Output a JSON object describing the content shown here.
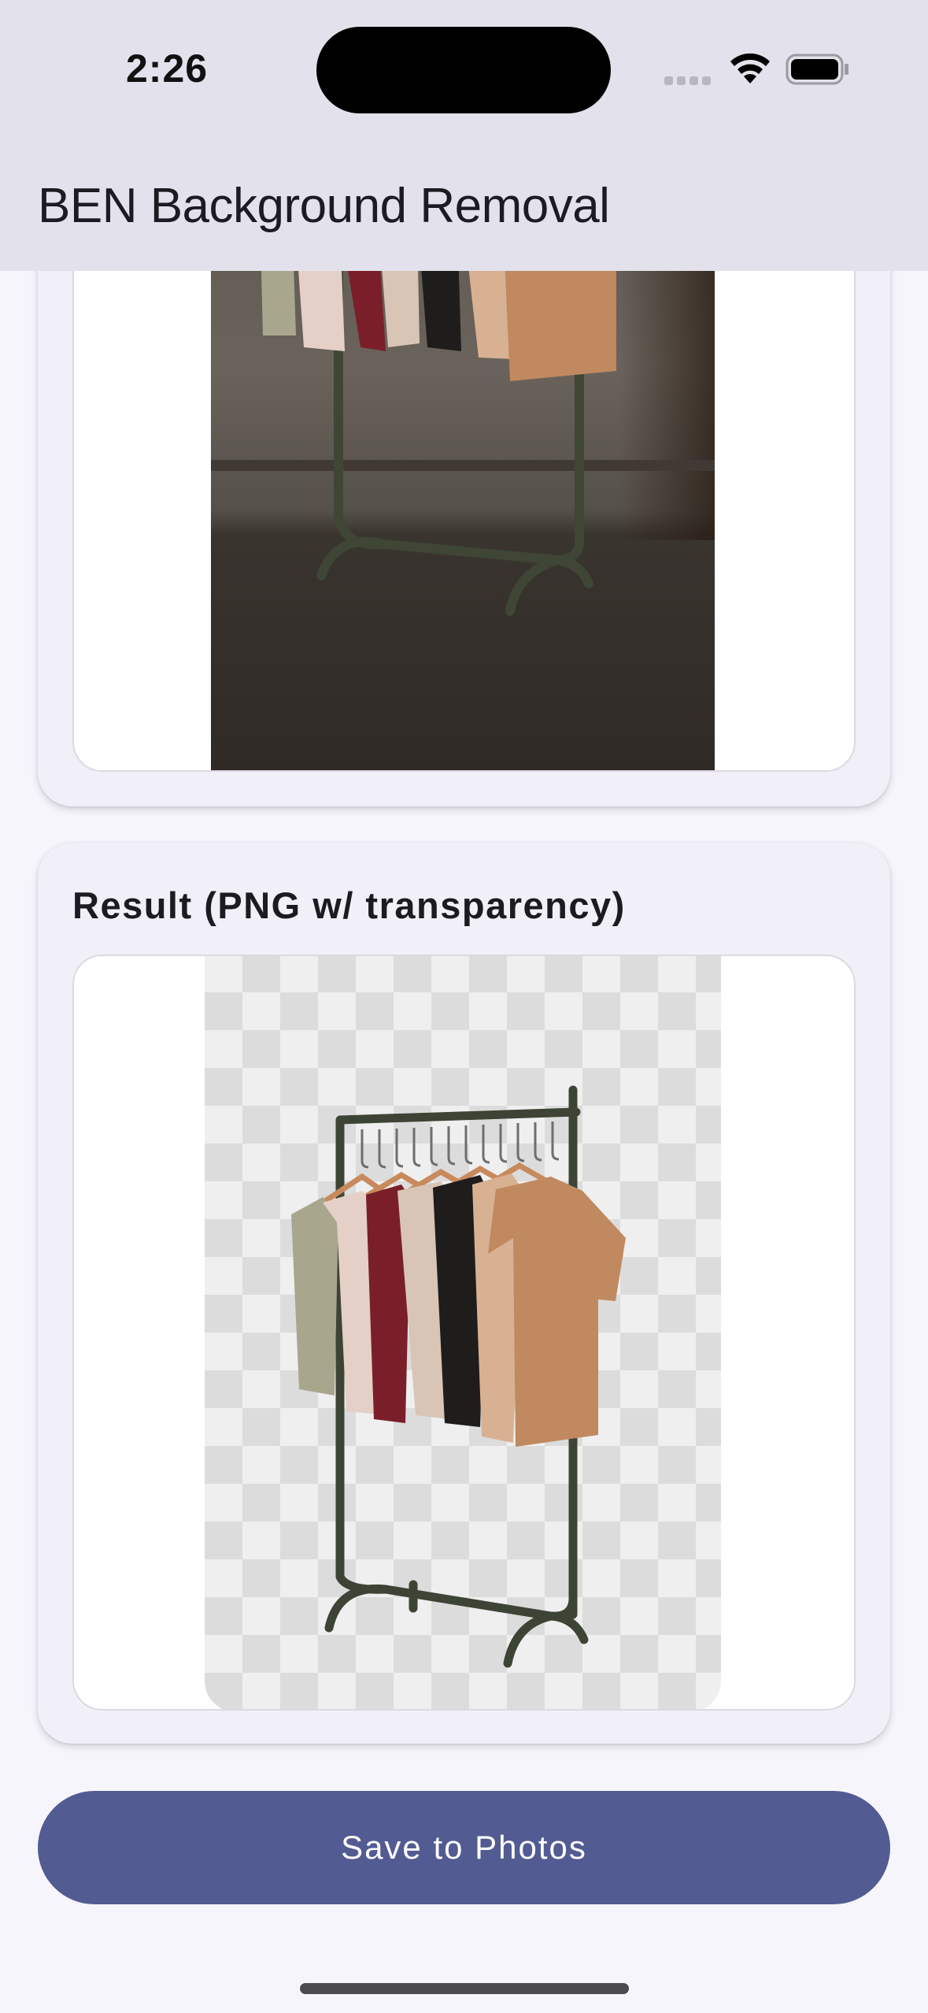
{
  "status_bar": {
    "time": "2:26"
  },
  "nav": {
    "title": "BEN Background Removal"
  },
  "original_card": {
    "image": "clothing-rack-photo"
  },
  "result_card": {
    "title": "Result (PNG w/ transparency)",
    "image": "clothing-rack-cutout"
  },
  "actions": {
    "save_label": "Save to Photos"
  },
  "colors": {
    "accent": "#525b92",
    "nav_background": "#e3e2ec",
    "page_background": "#f7f5fc",
    "card_background": "#f1eff7"
  },
  "shirt_colors": [
    "#a9a68e",
    "#e4d0c6",
    "#7a1f2a",
    "#d8c5b6",
    "#1f1c1c",
    "#d8b193",
    "#c0895f"
  ]
}
